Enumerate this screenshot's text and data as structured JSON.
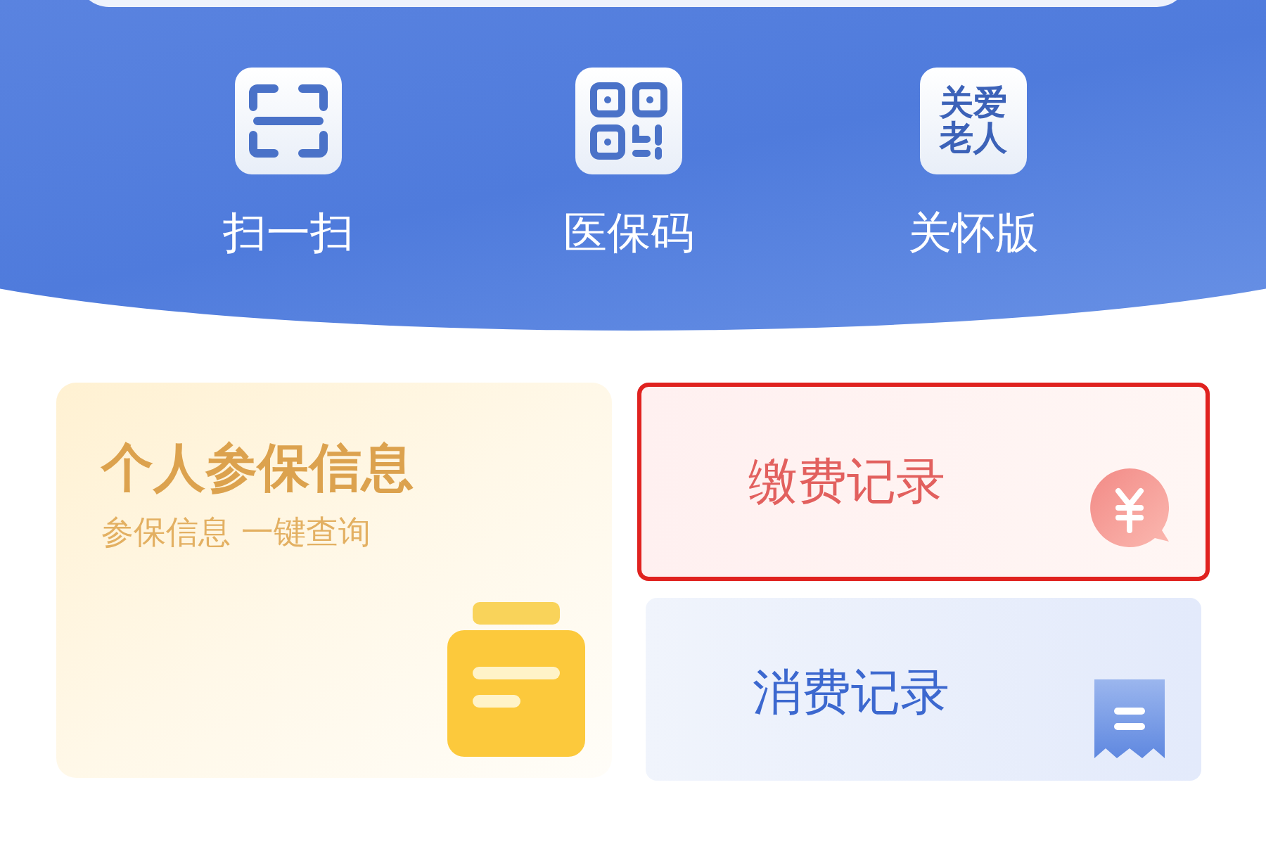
{
  "shortcuts": [
    {
      "kind": "scan",
      "label": "扫一扫"
    },
    {
      "kind": "qr",
      "label": "医保码"
    },
    {
      "kind": "text",
      "icon_text": [
        "关爱",
        "老人"
      ],
      "label": "关怀版"
    }
  ],
  "info_card": {
    "title": "个人参保信息",
    "subtitle": "参保信息 一键查询"
  },
  "record_cards": [
    {
      "kind": "payment",
      "label": "缴费记录",
      "highlighted": true
    },
    {
      "kind": "consumption",
      "label": "消费记录",
      "highlighted": false
    }
  ]
}
